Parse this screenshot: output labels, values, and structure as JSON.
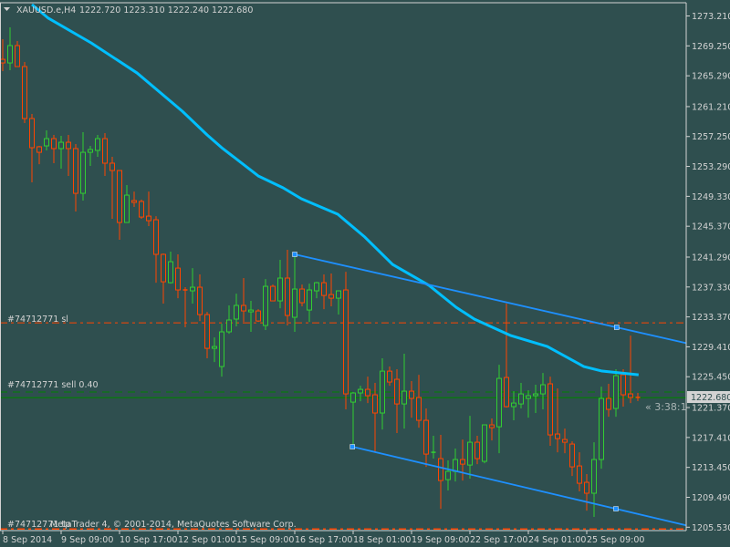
{
  "header": {
    "symbol": "XAUUSD.e,H4",
    "ohlc": "1222.720 1223.310 1222.240 1222.680",
    "menu_icon": "triangle-down-icon"
  },
  "colors": {
    "background": "#2F4F4F",
    "text": "#D3D3D3",
    "bull": "#32CD32",
    "bear": "#FF4500",
    "moving_average": "#00BFFF",
    "trendline": "#1E90FF",
    "order_line": "#008000",
    "stop_line": "#FF4500"
  },
  "orders": {
    "sl_label": "#74712771 sl",
    "sell_label": "#74712771 sell 0.40",
    "tp_label": "#74712771 tp",
    "sl_price": 1232.59,
    "sell_price": 1223.42,
    "tp_price": 1205.3
  },
  "copyright": "MetaTrader 4, © 2001-2014, MetaQuotes Software Corp.",
  "current_price_label": "1222.680",
  "countdown": "« 3:38:1",
  "chart_data": {
    "type": "candlestick",
    "title": "XAUUSD.e,H4",
    "ylim": [
      1205.53,
      1273.21
    ],
    "y_ticks": [
      "1273.210",
      "1269.250",
      "1265.290",
      "1261.210",
      "1257.250",
      "1253.290",
      "1249.330",
      "1245.370",
      "1241.290",
      "1237.330",
      "1233.370",
      "1229.410",
      "1225.450",
      "1221.370",
      "1217.410",
      "1213.450",
      "1209.490",
      "1205.530"
    ],
    "x_ticks": [
      {
        "index": 0,
        "label": "8 Sep 2014"
      },
      {
        "index": 8,
        "label": "9 Sep 09:00"
      },
      {
        "index": 16,
        "label": "10 Sep 17:00"
      },
      {
        "index": 24,
        "label": "12 Sep 01:00"
      },
      {
        "index": 32,
        "label": "15 Sep 09:00"
      },
      {
        "index": 40,
        "label": "16 Sep 17:00"
      },
      {
        "index": 48,
        "label": "18 Sep 01:00"
      },
      {
        "index": 56,
        "label": "19 Sep 09:00"
      },
      {
        "index": 64,
        "label": "22 Sep 17:00"
      },
      {
        "index": 72,
        "label": "24 Sep 01:00"
      },
      {
        "index": 80,
        "label": "25 Sep 09:00"
      }
    ],
    "ohlc": [
      [
        1267.47,
        1270.13,
        1265.91,
        1266.99
      ],
      [
        1266.99,
        1271.7,
        1266.03,
        1269.29
      ],
      [
        1269.29,
        1269.89,
        1266.51,
        1266.51
      ],
      [
        1266.51,
        1267.11,
        1259.03,
        1259.63
      ],
      [
        1259.63,
        1260.23,
        1251.18,
        1255.77
      ],
      [
        1255.89,
        1256.01,
        1253.59,
        1255.16
      ],
      [
        1256.01,
        1258.06,
        1255.41,
        1256.97
      ],
      [
        1256.97,
        1257.46,
        1253.72,
        1255.65
      ],
      [
        1255.65,
        1257.34,
        1252.99,
        1256.49
      ],
      [
        1256.49,
        1257.46,
        1252.03,
        1255.65
      ],
      [
        1255.65,
        1256.25,
        1247.32,
        1249.73
      ],
      [
        1249.73,
        1257.82,
        1248.77,
        1255.16
      ],
      [
        1255.16,
        1256.01,
        1253.35,
        1255.53
      ],
      [
        1255.41,
        1257.46,
        1254.56,
        1256.97
      ],
      [
        1256.97,
        1257.7,
        1252.03,
        1253.72
      ],
      [
        1253.72,
        1254.56,
        1246.35,
        1252.75
      ],
      [
        1252.75,
        1252.75,
        1243.58,
        1245.87
      ],
      [
        1245.87,
        1250.82,
        1245.87,
        1249.49
      ],
      [
        1248.77,
        1249.97,
        1247.92,
        1248.53
      ],
      [
        1248.65,
        1248.89,
        1246.35,
        1246.59
      ],
      [
        1246.71,
        1249.97,
        1245.39,
        1246.11
      ],
      [
        1246.23,
        1246.71,
        1237.9,
        1241.65
      ],
      [
        1241.65,
        1241.77,
        1235.13,
        1238.02
      ],
      [
        1237.9,
        1242.01,
        1237.78,
        1240.68
      ],
      [
        1239.83,
        1241.65,
        1235.85,
        1236.94
      ],
      [
        1236.94,
        1237.3,
        1231.99,
        1236.82
      ],
      [
        1236.82,
        1239.83,
        1235.13,
        1237.3
      ],
      [
        1237.3,
        1238.99,
        1232.83,
        1233.68
      ],
      [
        1233.68,
        1234.04,
        1227.89,
        1229.21
      ],
      [
        1229.21,
        1230.66,
        1227.4,
        1229.45
      ],
      [
        1226.8,
        1232.47,
        1225.47,
        1231.39
      ],
      [
        1231.39,
        1234.89,
        1231.14,
        1232.96
      ],
      [
        1233.08,
        1236.45,
        1232.11,
        1234.89
      ],
      [
        1234.89,
        1238.51,
        1232.71,
        1234.16
      ],
      [
        1234.04,
        1235.49,
        1231.39,
        1234.28
      ],
      [
        1234.16,
        1234.4,
        1232.71,
        1232.83
      ],
      [
        1232.23,
        1238.38,
        1231.63,
        1237.42
      ],
      [
        1237.42,
        1237.66,
        1235.49,
        1235.49
      ],
      [
        1235.49,
        1240.92,
        1234.52,
        1238.51
      ],
      [
        1238.51,
        1242.25,
        1232.23,
        1233.56
      ],
      [
        1233.32,
        1241.52,
        1231.39,
        1237.06
      ],
      [
        1237.06,
        1237.66,
        1234.77,
        1235.25
      ],
      [
        1234.28,
        1237.78,
        1232.71,
        1236.94
      ],
      [
        1236.82,
        1238.02,
        1235.85,
        1237.9
      ],
      [
        1237.9,
        1238.99,
        1234.4,
        1236.21
      ],
      [
        1236.33,
        1239.11,
        1234.77,
        1235.85
      ],
      [
        1235.85,
        1236.82,
        1233.68,
        1236.82
      ],
      [
        1236.94,
        1239.35,
        1221.13,
        1223.18
      ],
      [
        1222.09,
        1223.42,
        1216.18,
        1223.3
      ],
      [
        1223.3,
        1224.26,
        1222.21,
        1223.78
      ],
      [
        1223.78,
        1225.47,
        1221.97,
        1222.94
      ],
      [
        1223.06,
        1224.63,
        1215.58,
        1220.65
      ],
      [
        1220.65,
        1227.89,
        1218.47,
        1226.19
      ],
      [
        1226.19,
        1226.8,
        1224.26,
        1224.75
      ],
      [
        1225.11,
        1226.44,
        1217.99,
        1221.85
      ],
      [
        1221.85,
        1228.49,
        1218.59,
        1223.54
      ],
      [
        1223.54,
        1224.87,
        1220.04,
        1222.58
      ],
      [
        1222.7,
        1225.71,
        1218.71,
        1219.68
      ],
      [
        1219.68,
        1221.25,
        1213.52,
        1215.21
      ],
      [
        1215.33,
        1217.63,
        1214.61,
        1215.45
      ],
      [
        1214.61,
        1217.75,
        1207.97,
        1211.71
      ],
      [
        1211.83,
        1214.37,
        1210.39,
        1212.92
      ],
      [
        1212.92,
        1215.94,
        1211.59,
        1214.49
      ],
      [
        1214.49,
        1217.14,
        1211.71,
        1213.88
      ],
      [
        1213.76,
        1220.28,
        1211.96,
        1216.78
      ],
      [
        1216.78,
        1217.63,
        1213.88,
        1214.61
      ],
      [
        1214.25,
        1219.08,
        1214.0,
        1219.08
      ],
      [
        1219.08,
        1219.92,
        1217.02,
        1218.71
      ],
      [
        1218.83,
        1227.04,
        1215.33,
        1225.23
      ],
      [
        1225.35,
        1235.13,
        1221.37,
        1221.49
      ],
      [
        1221.49,
        1223.54,
        1219.68,
        1221.97
      ],
      [
        1221.85,
        1224.63,
        1221.25,
        1223.18
      ],
      [
        1222.58,
        1223.66,
        1220.04,
        1222.94
      ],
      [
        1222.94,
        1224.39,
        1220.65,
        1223.18
      ],
      [
        1223.18,
        1225.95,
        1221.13,
        1224.39
      ],
      [
        1224.51,
        1225.47,
        1216.3,
        1217.75
      ],
      [
        1217.87,
        1223.9,
        1215.45,
        1217.26
      ],
      [
        1217.14,
        1218.59,
        1215.33,
        1216.78
      ],
      [
        1216.54,
        1216.9,
        1212.31,
        1213.52
      ],
      [
        1213.64,
        1215.45,
        1210.27,
        1211.35
      ],
      [
        1211.47,
        1212.56,
        1207.73,
        1210.03
      ],
      [
        1210.03,
        1216.78,
        1206.89,
        1214.49
      ],
      [
        1214.49,
        1224.14,
        1213.28,
        1222.58
      ],
      [
        1222.58,
        1224.51,
        1220.16,
        1221.13
      ],
      [
        1221.25,
        1226.44,
        1220.16,
        1225.59
      ],
      [
        1225.71,
        1226.44,
        1221.49,
        1223.06
      ],
      [
        1223.18,
        1230.9,
        1221.97,
        1222.7
      ],
      [
        1222.72,
        1223.31,
        1222.24,
        1222.68
      ]
    ],
    "moving_average": [
      [
        4,
        1274.72
      ],
      [
        6.25,
        1272.91
      ],
      [
        12.1,
        1269.65
      ],
      [
        18.4,
        1265.66
      ],
      [
        24.6,
        1260.6
      ],
      [
        28,
        1257.46
      ],
      [
        30,
        1255.77
      ],
      [
        35,
        1252.03
      ],
      [
        38.4,
        1250.46
      ],
      [
        40.9,
        1249.01
      ],
      [
        45.9,
        1246.96
      ],
      [
        49.6,
        1243.94
      ],
      [
        53.4,
        1240.32
      ],
      [
        58.4,
        1237.54
      ],
      [
        62.1,
        1234.65
      ],
      [
        64.6,
        1233.08
      ],
      [
        69.6,
        1230.9
      ],
      [
        74.6,
        1229.45
      ],
      [
        79.6,
        1226.8
      ],
      [
        82.1,
        1226.2
      ],
      [
        87.1,
        1225.71
      ]
    ],
    "channel": {
      "upper": [
        [
          40,
          1241.65
        ],
        [
          84.1,
          1231.99
        ]
      ],
      "lower": [
        [
          47.9,
          1216.18
        ],
        [
          84,
          1207.97
        ]
      ]
    },
    "current_price": 1222.68
  }
}
